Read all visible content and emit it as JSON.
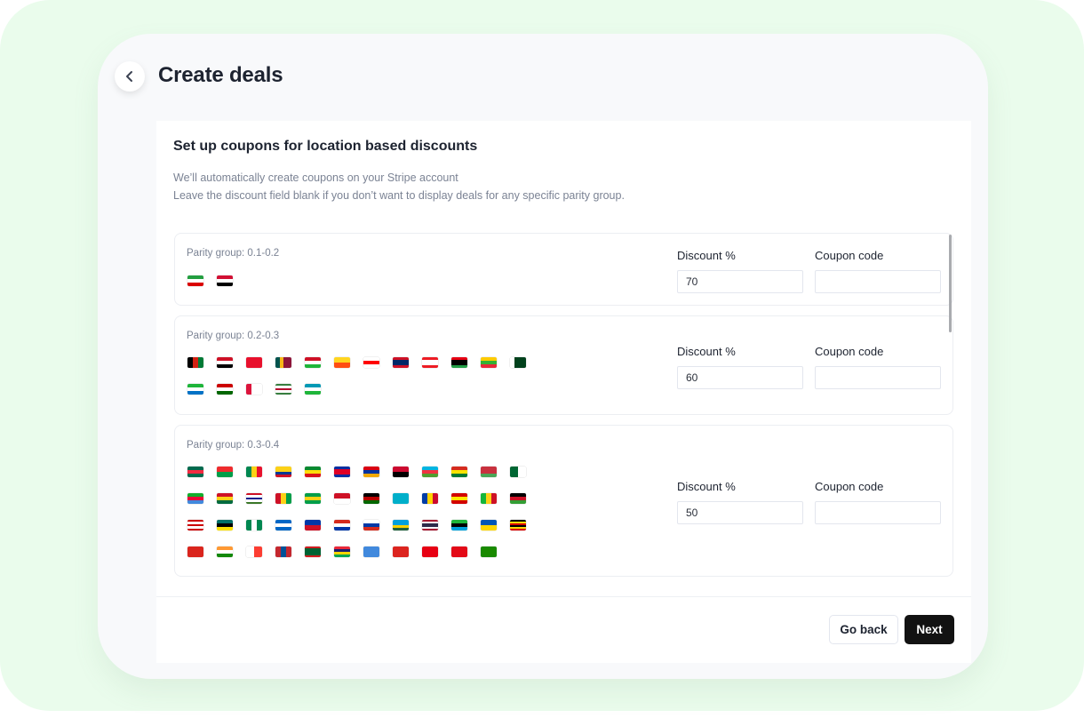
{
  "page": {
    "title": "Create deals",
    "back_icon": "chevron-left-icon"
  },
  "panel": {
    "title": "Set up coupons for location based discounts",
    "desc_line1": "We’ll automatically create coupons on your Stripe account",
    "desc_line2": "Leave the discount field blank if you don’t want to display deals for any specific parity group."
  },
  "groups": [
    {
      "label": "Parity group: 0.1-0.2",
      "discount_label": "Discount %",
      "coupon_label": "Coupon code",
      "discount_value": "70",
      "coupon_value": "",
      "flags": [
        {
          "code": "IR",
          "dir": "h",
          "colors": [
            "#239f40",
            "#ffffff",
            "#da0000"
          ]
        },
        {
          "code": "SD",
          "dir": "h",
          "colors": [
            "#d21034",
            "#ffffff",
            "#000000"
          ]
        }
      ]
    },
    {
      "label": "Parity group: 0.2-0.3",
      "discount_label": "Discount %",
      "coupon_label": "Coupon code",
      "discount_value": "60",
      "coupon_value": "",
      "flags": [
        {
          "code": "AF",
          "dir": "v",
          "colors": [
            "#000000",
            "#d32011",
            "#007a36"
          ]
        },
        {
          "code": "EG",
          "dir": "h",
          "colors": [
            "#ce1126",
            "#ffffff",
            "#000000"
          ]
        },
        {
          "code": "KG",
          "dir": "h",
          "colors": [
            "#e8112d",
            "#e8112d",
            "#e8112d"
          ]
        },
        {
          "code": "LK",
          "dir": "v",
          "colors": [
            "#00534e",
            "#f7b718",
            "#8d153a",
            "#8d153a"
          ]
        },
        {
          "code": "BI",
          "dir": "h",
          "colors": [
            "#ce1126",
            "#ffffff",
            "#1eb53a"
          ]
        },
        {
          "code": "BT",
          "dir": "h",
          "colors": [
            "#ffd520",
            "#ff4e12"
          ]
        },
        {
          "code": "GE",
          "dir": "h",
          "colors": [
            "#ffffff",
            "#ff0000",
            "#ffffff"
          ]
        },
        {
          "code": "LA",
          "dir": "h",
          "colors": [
            "#ce1126",
            "#002868",
            "#002868",
            "#ce1126"
          ]
        },
        {
          "code": "LB",
          "dir": "h",
          "colors": [
            "#ed1c24",
            "#ffffff",
            "#ffffff",
            "#ed1c24"
          ]
        },
        {
          "code": "LY",
          "dir": "h",
          "colors": [
            "#e70013",
            "#000000",
            "#000000",
            "#239e46"
          ]
        },
        {
          "code": "MM",
          "dir": "h",
          "colors": [
            "#fecb00",
            "#34b233",
            "#ea2839"
          ]
        },
        {
          "code": "PK",
          "dir": "v",
          "colors": [
            "#ffffff",
            "#01411c",
            "#01411c",
            "#01411c"
          ]
        },
        {
          "code": "SL",
          "dir": "h",
          "colors": [
            "#1eb53a",
            "#ffffff",
            "#0072c6"
          ]
        },
        {
          "code": "TJ",
          "dir": "h",
          "colors": [
            "#cc0000",
            "#ffffff",
            "#006600"
          ]
        },
        {
          "code": "NP",
          "dir": "v",
          "colors": [
            "#dc143c",
            "#ffffff",
            "#ffffff"
          ]
        },
        {
          "code": "SR",
          "dir": "h",
          "colors": [
            "#377e3f",
            "#ffffff",
            "#b40a2d",
            "#ffffff",
            "#377e3f"
          ]
        },
        {
          "code": "UZ",
          "dir": "h",
          "colors": [
            "#0099b5",
            "#ffffff",
            "#1eb53a"
          ]
        }
      ]
    },
    {
      "label": "Parity group: 0.3-0.4",
      "discount_label": "Discount %",
      "coupon_label": "Coupon code",
      "discount_value": "50",
      "coupon_value": "",
      "flags": [
        {
          "code": "BD",
          "dir": "h",
          "colors": [
            "#006a4e",
            "#f42a41",
            "#006a4e"
          ]
        },
        {
          "code": "BF",
          "dir": "h",
          "colors": [
            "#ef2b2d",
            "#009e49"
          ]
        },
        {
          "code": "BJ",
          "dir": "v",
          "colors": [
            "#008751",
            "#fcd116",
            "#e8112d"
          ]
        },
        {
          "code": "CO",
          "dir": "h",
          "colors": [
            "#fcd116",
            "#fcd116",
            "#003893",
            "#ce1126"
          ]
        },
        {
          "code": "ET",
          "dir": "h",
          "colors": [
            "#078930",
            "#fcdd09",
            "#da121a"
          ]
        },
        {
          "code": "KH",
          "dir": "h",
          "colors": [
            "#032ea1",
            "#e00025",
            "#e00025",
            "#032ea1"
          ]
        },
        {
          "code": "AM",
          "dir": "h",
          "colors": [
            "#d90012",
            "#0033a0",
            "#f2a800"
          ]
        },
        {
          "code": "AO",
          "dir": "h",
          "colors": [
            "#cc092f",
            "#000000"
          ]
        },
        {
          "code": "AZ",
          "dir": "h",
          "colors": [
            "#00b5e2",
            "#ef3340",
            "#509e2f"
          ]
        },
        {
          "code": "BO",
          "dir": "h",
          "colors": [
            "#d52b1e",
            "#f9e300",
            "#007934"
          ]
        },
        {
          "code": "BY",
          "dir": "h",
          "colors": [
            "#c8313e",
            "#c8313e",
            "#4aa657"
          ]
        },
        {
          "code": "DZ",
          "dir": "v",
          "colors": [
            "#006633",
            "#ffffff"
          ]
        },
        {
          "code": "ER",
          "dir": "h",
          "colors": [
            "#12ad2b",
            "#ea0437",
            "#4189dd"
          ]
        },
        {
          "code": "GH",
          "dir": "h",
          "colors": [
            "#ce1126",
            "#fcd116",
            "#006b3f"
          ]
        },
        {
          "code": "GM",
          "dir": "h",
          "colors": [
            "#ce1126",
            "#ffffff",
            "#0c1c8c",
            "#ffffff",
            "#3a7728"
          ]
        },
        {
          "code": "GW",
          "dir": "v",
          "colors": [
            "#ce1126",
            "#fcd116",
            "#009e49"
          ]
        },
        {
          "code": "GY",
          "dir": "h",
          "colors": [
            "#009e49",
            "#fcd116",
            "#009e49"
          ]
        },
        {
          "code": "ID",
          "dir": "h",
          "colors": [
            "#ce1126",
            "#ffffff"
          ]
        },
        {
          "code": "KE",
          "dir": "h",
          "colors": [
            "#000000",
            "#bb0000",
            "#006600"
          ]
        },
        {
          "code": "KZ",
          "dir": "h",
          "colors": [
            "#00afca",
            "#00afca"
          ]
        },
        {
          "code": "MD",
          "dir": "v",
          "colors": [
            "#003da5",
            "#ffd200",
            "#cc092f"
          ]
        },
        {
          "code": "MK",
          "dir": "h",
          "colors": [
            "#d20000",
            "#ffe600",
            "#d20000"
          ]
        },
        {
          "code": "ML",
          "dir": "v",
          "colors": [
            "#14b53a",
            "#fcd116",
            "#ce1126"
          ]
        },
        {
          "code": "MW",
          "dir": "h",
          "colors": [
            "#000000",
            "#ce1126",
            "#339e35"
          ]
        },
        {
          "code": "MY",
          "dir": "h",
          "colors": [
            "#cc0001",
            "#ffffff",
            "#cc0001",
            "#ffffff",
            "#cc0001"
          ]
        },
        {
          "code": "MZ",
          "dir": "h",
          "colors": [
            "#007168",
            "#000000",
            "#fce100"
          ]
        },
        {
          "code": "NG",
          "dir": "v",
          "colors": [
            "#008751",
            "#ffffff",
            "#008751"
          ]
        },
        {
          "code": "NI",
          "dir": "h",
          "colors": [
            "#0067c6",
            "#ffffff",
            "#0067c6"
          ]
        },
        {
          "code": "PH",
          "dir": "h",
          "colors": [
            "#0038a8",
            "#ce1126"
          ]
        },
        {
          "code": "PY",
          "dir": "h",
          "colors": [
            "#d52b1e",
            "#ffffff",
            "#0038a8"
          ]
        },
        {
          "code": "RU",
          "dir": "h",
          "colors": [
            "#ffffff",
            "#0039a6",
            "#d52b1e"
          ]
        },
        {
          "code": "RW",
          "dir": "h",
          "colors": [
            "#00a1de",
            "#00a1de",
            "#fad201",
            "#20603d"
          ]
        },
        {
          "code": "TH",
          "dir": "h",
          "colors": [
            "#a51931",
            "#f4f5f8",
            "#2d2a4a",
            "#2d2a4a",
            "#f4f5f8",
            "#a51931"
          ]
        },
        {
          "code": "TZ",
          "dir": "h",
          "colors": [
            "#1eb53a",
            "#000000",
            "#00a3dd"
          ]
        },
        {
          "code": "UA",
          "dir": "h",
          "colors": [
            "#0057b7",
            "#ffd700"
          ]
        },
        {
          "code": "UG",
          "dir": "h",
          "colors": [
            "#000000",
            "#fcdc04",
            "#d90000",
            "#000000",
            "#fcdc04",
            "#d90000"
          ]
        },
        {
          "code": "VN",
          "dir": "h",
          "colors": [
            "#da251d",
            "#da251d"
          ]
        },
        {
          "code": "IN",
          "dir": "h",
          "colors": [
            "#ff9933",
            "#ffffff",
            "#138808"
          ]
        },
        {
          "code": "MG",
          "dir": "v",
          "colors": [
            "#ffffff",
            "#fc3d32"
          ]
        },
        {
          "code": "MN",
          "dir": "v",
          "colors": [
            "#c4272f",
            "#015197",
            "#c4272f"
          ]
        },
        {
          "code": "MR",
          "dir": "h",
          "colors": [
            "#d01c1f",
            "#006233",
            "#006233",
            "#006233",
            "#d01c1f"
          ]
        },
        {
          "code": "MU",
          "dir": "h",
          "colors": [
            "#ea2839",
            "#1a206d",
            "#ffd500",
            "#00a551"
          ]
        },
        {
          "code": "SO",
          "dir": "h",
          "colors": [
            "#4189dd",
            "#4189dd"
          ]
        },
        {
          "code": "TL",
          "dir": "h",
          "colors": [
            "#dc241f",
            "#dc241f"
          ]
        },
        {
          "code": "TN",
          "dir": "h",
          "colors": [
            "#e70013",
            "#e70013"
          ]
        },
        {
          "code": "TR",
          "dir": "h",
          "colors": [
            "#e30a17",
            "#e30a17"
          ]
        },
        {
          "code": "ZM",
          "dir": "h",
          "colors": [
            "#198a00",
            "#198a00"
          ]
        }
      ]
    }
  ],
  "footer": {
    "go_back_label": "Go back",
    "next_label": "Next"
  }
}
